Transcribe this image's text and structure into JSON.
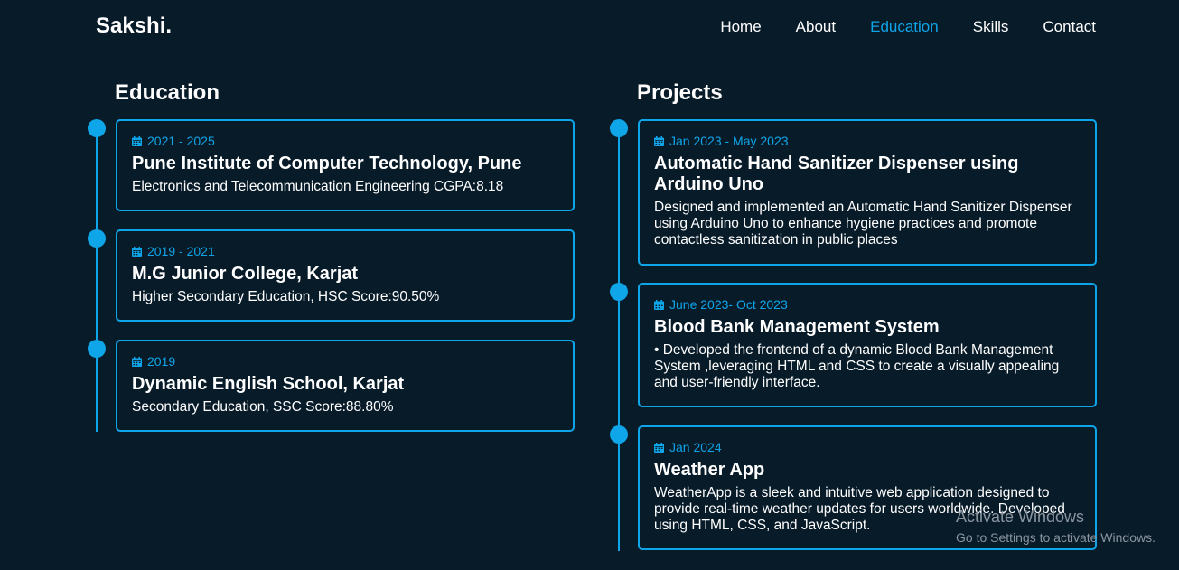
{
  "nav": {
    "logo": "Sakshi.",
    "links": [
      "Home",
      "About",
      "Education",
      "Skills",
      "Contact"
    ],
    "active_index": 2,
    "accent_color": "#0ea5e9"
  },
  "education": {
    "heading": "Education",
    "items": [
      {
        "date": "2021 - 2025",
        "title": "Pune Institute of Computer Technology, Pune",
        "desc": "Electronics and Telecommunication Engineering CGPA:8.18"
      },
      {
        "date": "2019 - 2021",
        "title": "M.G Junior College, Karjat",
        "desc": "Higher Secondary Education, HSC Score:90.50%"
      },
      {
        "date": "2019",
        "title": "Dynamic English School, Karjat",
        "desc": "Secondary Education, SSC Score:88.80%"
      }
    ]
  },
  "projects": {
    "heading": "Projects",
    "items": [
      {
        "date": "Jan 2023 - May 2023",
        "title": "Automatic Hand Sanitizer Dispenser using Arduino Uno",
        "desc": "Designed and implemented an Automatic Hand Sanitizer Dispenser using Arduino Uno to enhance hygiene practices and promote contactless sanitization in public places"
      },
      {
        "date": "June 2023- Oct 2023",
        "title": "Blood Bank Management System",
        "desc": "• Developed the frontend of a dynamic Blood Bank Management System ,leveraging HTML and CSS to create a visually appealing and user-friendly interface."
      },
      {
        "date": "Jan 2024",
        "title": "Weather App",
        "desc": "WeatherApp is a sleek and intuitive web application designed to provide real-time weather updates for users worldwide. Developed using HTML, CSS, and JavaScript."
      }
    ]
  },
  "watermark": {
    "line1": "Activate Windows",
    "line2": "Go to Settings to activate Windows."
  }
}
